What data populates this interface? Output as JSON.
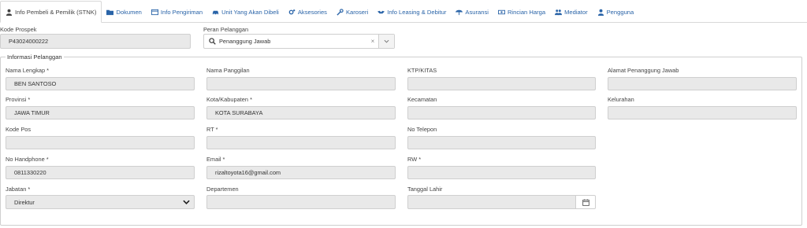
{
  "tabs": [
    {
      "label": "Info Pembeli & Pemilik (STNK)",
      "icon": "user-icon",
      "active": true
    },
    {
      "label": "Dokumen",
      "icon": "folder-icon"
    },
    {
      "label": "Info Pengiriman",
      "icon": "window-icon"
    },
    {
      "label": "Unit Yang Akan Dibeli",
      "icon": "car-icon"
    },
    {
      "label": "Aksesories",
      "icon": "cogs-icon"
    },
    {
      "label": "Karoseri",
      "icon": "wrench-icon"
    },
    {
      "label": "Info Leasing & Debitur",
      "icon": "handshake-icon"
    },
    {
      "label": "Asuransi",
      "icon": "umbrella-icon"
    },
    {
      "label": "Rincian Harga",
      "icon": "money-icon"
    },
    {
      "label": "Mediator",
      "icon": "users-icon"
    },
    {
      "label": "Pengguna",
      "icon": "user-icon"
    }
  ],
  "top": {
    "kode_prospek_label": "Kode Prospek",
    "kode_prospek_value": "P43024000222",
    "peran_label": "Peran Pelanggan",
    "peran_value": "Penanggung Jawab",
    "peran_clear": "×"
  },
  "section_title": "Informasi Pelanggan",
  "form": {
    "nama_lengkap_label": "Nama Lengkap *",
    "nama_lengkap_value": "BEN SANTOSO",
    "nama_panggilan_label": "Nama Panggilan",
    "ktp_label": "KTP/KITAS",
    "alamat_pj_label": "Alamat Penanggung Jawab",
    "provinsi_label": "Provinsi *",
    "provinsi_value": "JAWA TIMUR",
    "kota_label": "Kota/Kabupaten *",
    "kota_value": "KOTA SURABAYA",
    "kecamatan_label": "Kecamatan",
    "kelurahan_label": "Kelurahan",
    "kode_pos_label": "Kode Pos",
    "rt_label": "RT *",
    "no_telepon_label": "No Telepon",
    "no_hp_label": "No Handphone *",
    "no_hp_value": "0811330220",
    "email_label": "Email *",
    "email_value": "rizaltoyota16@gmail.com",
    "rw_label": "RW *",
    "jabatan_label": "Jabatan *",
    "jabatan_value": "Direktur",
    "departemen_label": "Departemen",
    "tanggal_lahir_label": "Tanggal Lahir"
  },
  "colors": {
    "link": "#2a64a8",
    "field_bg": "#e9e9e9",
    "border": "#cfcfcf"
  }
}
